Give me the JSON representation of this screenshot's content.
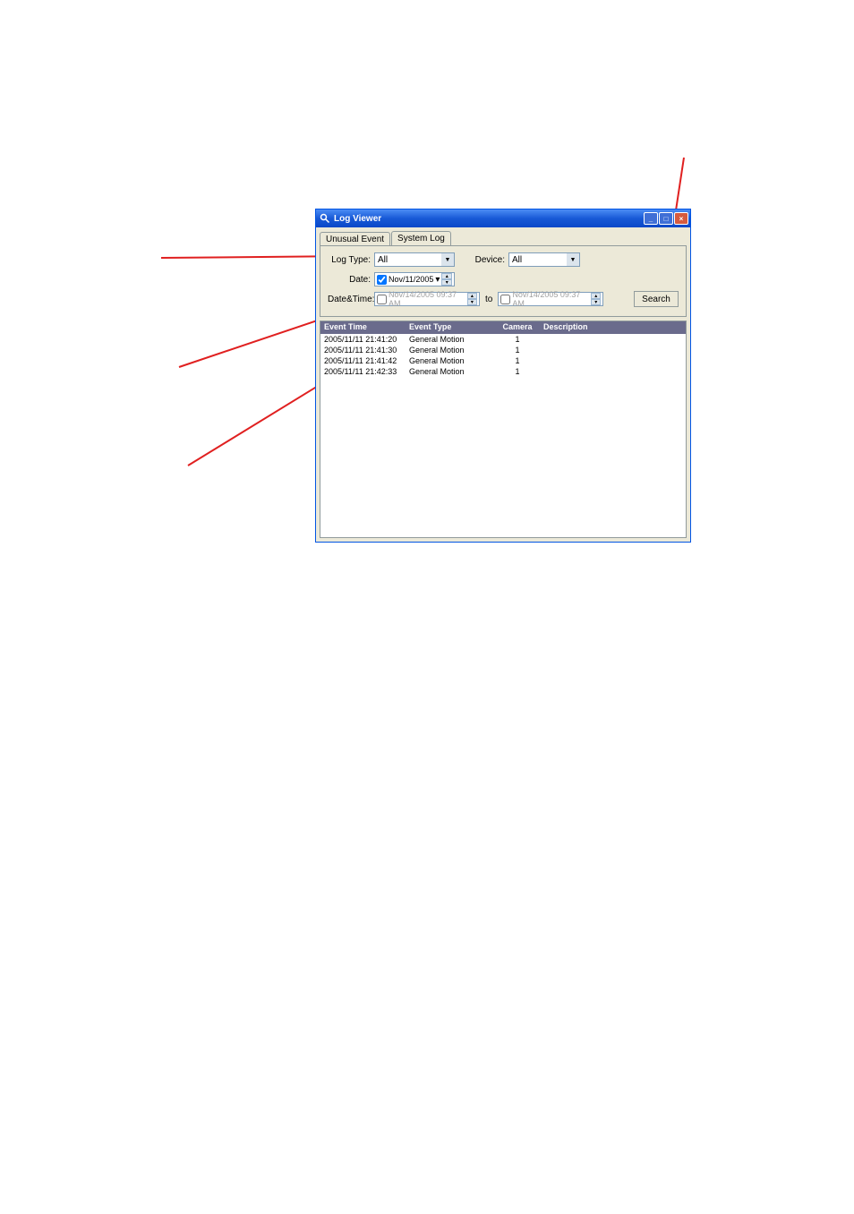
{
  "titlebar": {
    "title": "Log Viewer"
  },
  "tabs": {
    "unusual": "Unusual Event",
    "system": "System Log"
  },
  "filters": {
    "logtype_label": "Log Type:",
    "logtype_value": "All",
    "device_label": "Device:",
    "device_value": "All",
    "date_label": "Date:",
    "date_value": "Nov/11/2005",
    "datetime_label": "Date&Time:",
    "dt_from": "Nov/14/2005 09:37 AM",
    "to": "to",
    "dt_to": "Nov/14/2005 09:37 AM",
    "search": "Search"
  },
  "columns": {
    "c1": "Event Time",
    "c2": "Event Type",
    "c3": "Camera",
    "c4": "Description"
  },
  "rows": [
    {
      "time": "2005/11/11 21:41:20",
      "type": "General Motion",
      "camera": "1",
      "desc": ""
    },
    {
      "time": "2005/11/11 21:41:30",
      "type": "General Motion",
      "camera": "1",
      "desc": ""
    },
    {
      "time": "2005/11/11 21:41:42",
      "type": "General Motion",
      "camera": "1",
      "desc": ""
    },
    {
      "time": "2005/11/11 21:42:33",
      "type": "General Motion",
      "camera": "1",
      "desc": ""
    }
  ]
}
